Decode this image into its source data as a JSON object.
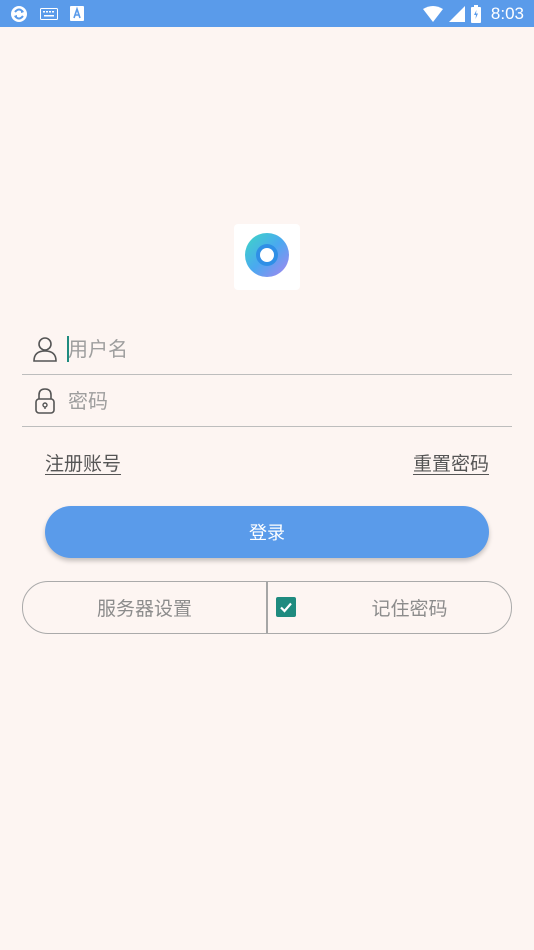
{
  "status_bar": {
    "time": "8:03",
    "left_icons": [
      "sync-icon",
      "keyboard-icon",
      "font-icon"
    ],
    "right_icons": [
      "wifi-icon",
      "signal-icon",
      "battery-icon"
    ],
    "background": "#5a9bea"
  },
  "app": {
    "logo_icon": "app-logo-icon",
    "accent": "#5a9bea",
    "check_color": "#1f8b7f"
  },
  "login_form": {
    "username": {
      "value": "",
      "placeholder": "用户名",
      "icon": "user-icon"
    },
    "password": {
      "value": "",
      "placeholder": "密码",
      "icon": "lock-icon"
    },
    "register_link": "注册账号",
    "reset_link": "重置密码",
    "login_button": "登录"
  },
  "bottom_bar": {
    "server_settings": "服务器设置",
    "remember_password": {
      "label": "记住密码",
      "checked": true
    }
  }
}
